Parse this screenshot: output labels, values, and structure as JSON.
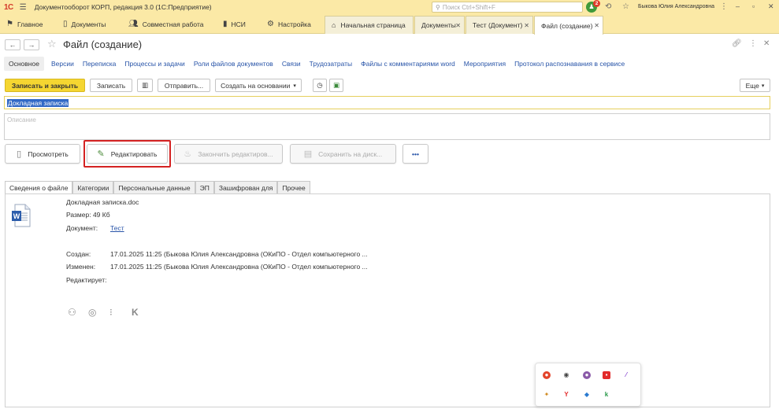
{
  "titlebar": {
    "logo": "1С",
    "app_title": "Документооборот КОРП, редакция 3.0  (1С:Предприятие)",
    "search_placeholder": "Поиск Ctrl+Shift+F",
    "notifications_count": "2",
    "user": "Быкова Юлия Александровна"
  },
  "sections": [
    {
      "label": "Главное"
    },
    {
      "label": "Документы"
    },
    {
      "label": "Совместная работа"
    },
    {
      "label": "НСИ"
    },
    {
      "label": "Настройка"
    }
  ],
  "open_tabs": [
    {
      "label": "Начальная страница"
    },
    {
      "label": "Документы"
    },
    {
      "label": "Тест (Документ)"
    },
    {
      "label": "Файл (создание)"
    }
  ],
  "form": {
    "title": "Файл (создание)",
    "links": [
      "Основное",
      "Версии",
      "Переписка",
      "Процессы и задачи",
      "Роли файлов документов",
      "Связи",
      "Трудозатраты",
      "Файлы с комментариями word",
      "Мероприятия",
      "Протокол распознавания в сервисе"
    ],
    "commands": {
      "save_close": "Записать и закрыть",
      "save": "Записать",
      "send": "Отправить...",
      "create_based": "Создать на основании",
      "more": "Еще"
    },
    "name_value": "Докладная записка",
    "description_placeholder": "Описание",
    "actions": {
      "view": "Просмотреть",
      "edit": "Редактировать",
      "finish_edit": "Закончить редактиров...",
      "save_disk": "Сохранить на диск...",
      "more": "•••"
    },
    "page_tabs": [
      "Сведения о файле",
      "Категории",
      "Персональные данные",
      "ЭП",
      "Зашифрован для",
      "Прочее"
    ],
    "file_info": {
      "file_name": "Докладная записка.doc",
      "size": "Размер: 49 Кб",
      "document_label": "Документ:",
      "document_value": "Тест",
      "created_label": "Создан:",
      "created_value": "17.01.2025 11:25 (Быкова Юлия Александровна (ОКиПО - Отдел компьютерного ...",
      "changed_label": "Изменен:",
      "changed_value": "17.01.2025 11:25 (Быкова Юлия Александровна (ОКиПО - Отдел компьютерного ...",
      "editing_label": "Редактирует:"
    }
  },
  "colors": {
    "accent_yellow": "#fbe9a6",
    "primary_button": "#f5d631",
    "link_blue": "#2854a8",
    "highlight_red": "#d42222"
  }
}
